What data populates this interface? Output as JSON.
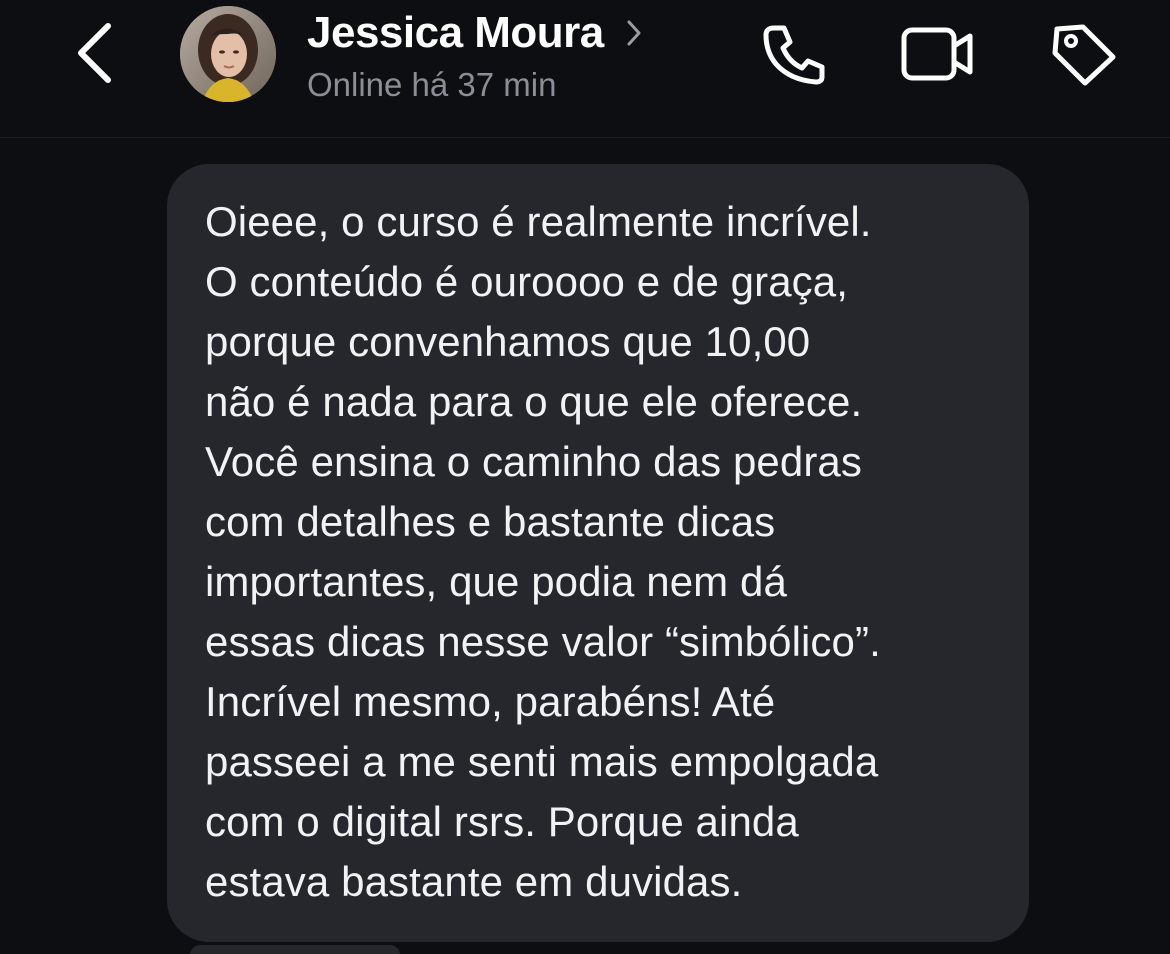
{
  "header": {
    "contact_name": "Jessica Moura",
    "status": "Online há 37 min",
    "icons": {
      "back": "chevron-left-icon",
      "profile_chevron": "chevron-right-icon",
      "call": "phone-icon",
      "video": "video-camera-icon",
      "tag": "tag-icon"
    }
  },
  "message": {
    "text": "Oieee, o curso é realmente incrível.\nO conteúdo é ouroooo e de graça,\nporque convenhamos que 10,00\nnão é nada para o que ele oferece.\nVocê ensina o caminho das pedras\ncom detalhes e bastante dicas\nimportantes, que podia nem dá\nessas dicas nesse valor “simbólico”.\nIncrível mesmo, parabéns! Até\npasseei a me senti mais empolgada\ncom o digital rsrs. Porque ainda\nestava bastante em duvidas."
  },
  "colors": {
    "background": "#0d0e12",
    "bubble": "#25272d",
    "text": "#f2f2f4",
    "status_text": "#8b8e96"
  }
}
